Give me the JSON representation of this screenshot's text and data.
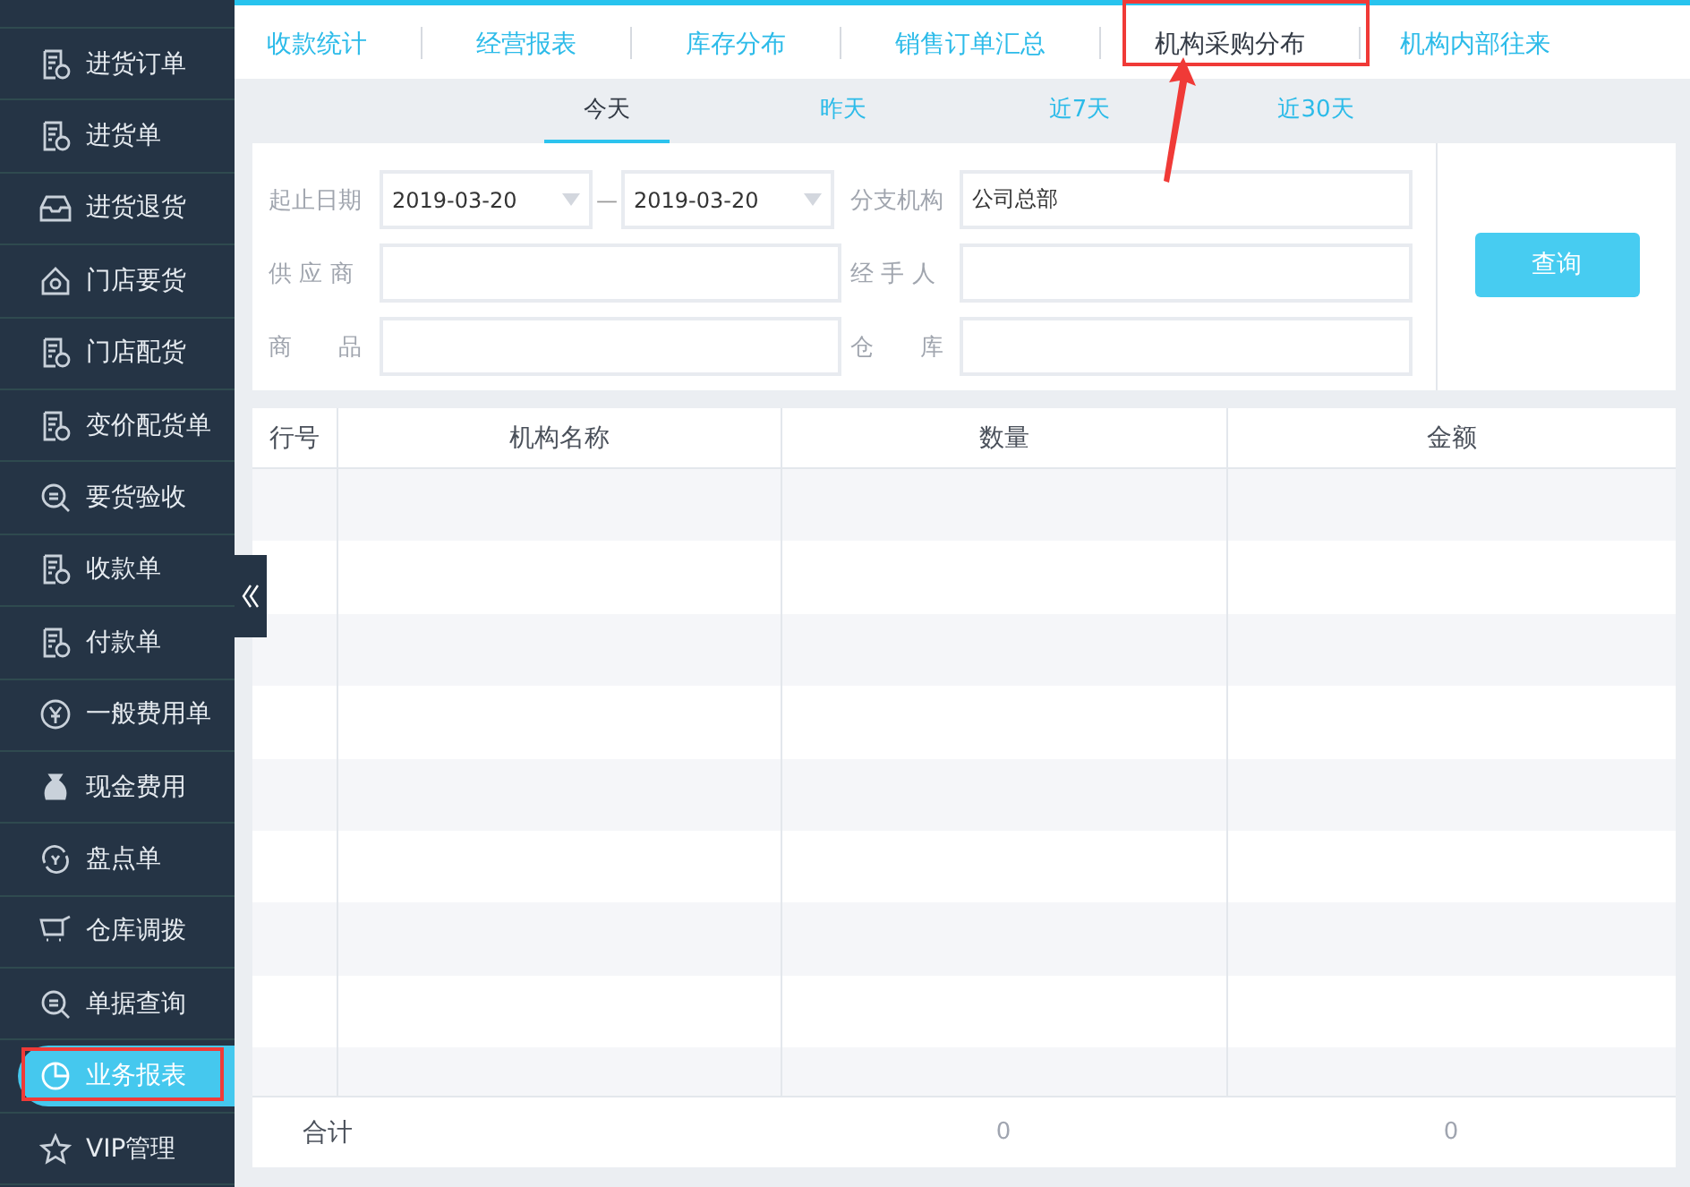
{
  "sidebar": {
    "items": [
      {
        "label": "进货订单",
        "selected": false,
        "highlighted": false
      },
      {
        "label": "进货单",
        "selected": false,
        "highlighted": false
      },
      {
        "label": "进货退货",
        "selected": false,
        "highlighted": false
      },
      {
        "label": "门店要货",
        "selected": false,
        "highlighted": false
      },
      {
        "label": "门店配货",
        "selected": false,
        "highlighted": false
      },
      {
        "label": "变价配货单",
        "selected": false,
        "highlighted": false
      },
      {
        "label": "要货验收",
        "selected": false,
        "highlighted": false
      },
      {
        "label": "收款单",
        "selected": false,
        "highlighted": false
      },
      {
        "label": "付款单",
        "selected": false,
        "highlighted": false
      },
      {
        "label": "一般费用单",
        "selected": false,
        "highlighted": false
      },
      {
        "label": "现金费用",
        "selected": false,
        "highlighted": false
      },
      {
        "label": "盘点单",
        "selected": false,
        "highlighted": false
      },
      {
        "label": "仓库调拨",
        "selected": false,
        "highlighted": false
      },
      {
        "label": "单据查询",
        "selected": false,
        "highlighted": false
      },
      {
        "label": "业务报表",
        "selected": true,
        "highlighted": true
      },
      {
        "label": "VIP管理",
        "selected": false,
        "highlighted": false
      }
    ]
  },
  "report_tabs": [
    {
      "label": "收款统计",
      "selected": false,
      "highlighted": false
    },
    {
      "label": "经营报表",
      "selected": false,
      "highlighted": false
    },
    {
      "label": "库存分布",
      "selected": false,
      "highlighted": false
    },
    {
      "label": "销售订单汇总",
      "selected": false,
      "highlighted": false
    },
    {
      "label": "机构采购分布",
      "selected": true,
      "highlighted": true
    },
    {
      "label": "机构内部往来",
      "selected": false,
      "highlighted": false
    }
  ],
  "date_tabs": [
    {
      "label": "今天",
      "selected": true
    },
    {
      "label": "昨天",
      "selected": false
    },
    {
      "label": "近7天",
      "selected": false
    },
    {
      "label": "近30天",
      "selected": false
    }
  ],
  "filters": {
    "date_label": "起止日期",
    "date_from": "2019-03-20",
    "date_separator": "—",
    "date_to": "2019-03-20",
    "branch_label": "分支机构",
    "branch": "公司总部",
    "supplier_label": "供 应 商",
    "handler_label": "经 手 人",
    "product_label": "商　　品",
    "warehouse_label": "仓　　库",
    "query_button": "查询"
  },
  "table": {
    "columns": [
      "行号",
      "机构名称",
      "数量",
      "金额"
    ],
    "footer": {
      "label": "合计",
      "quantity": "0",
      "amount": "0"
    }
  }
}
